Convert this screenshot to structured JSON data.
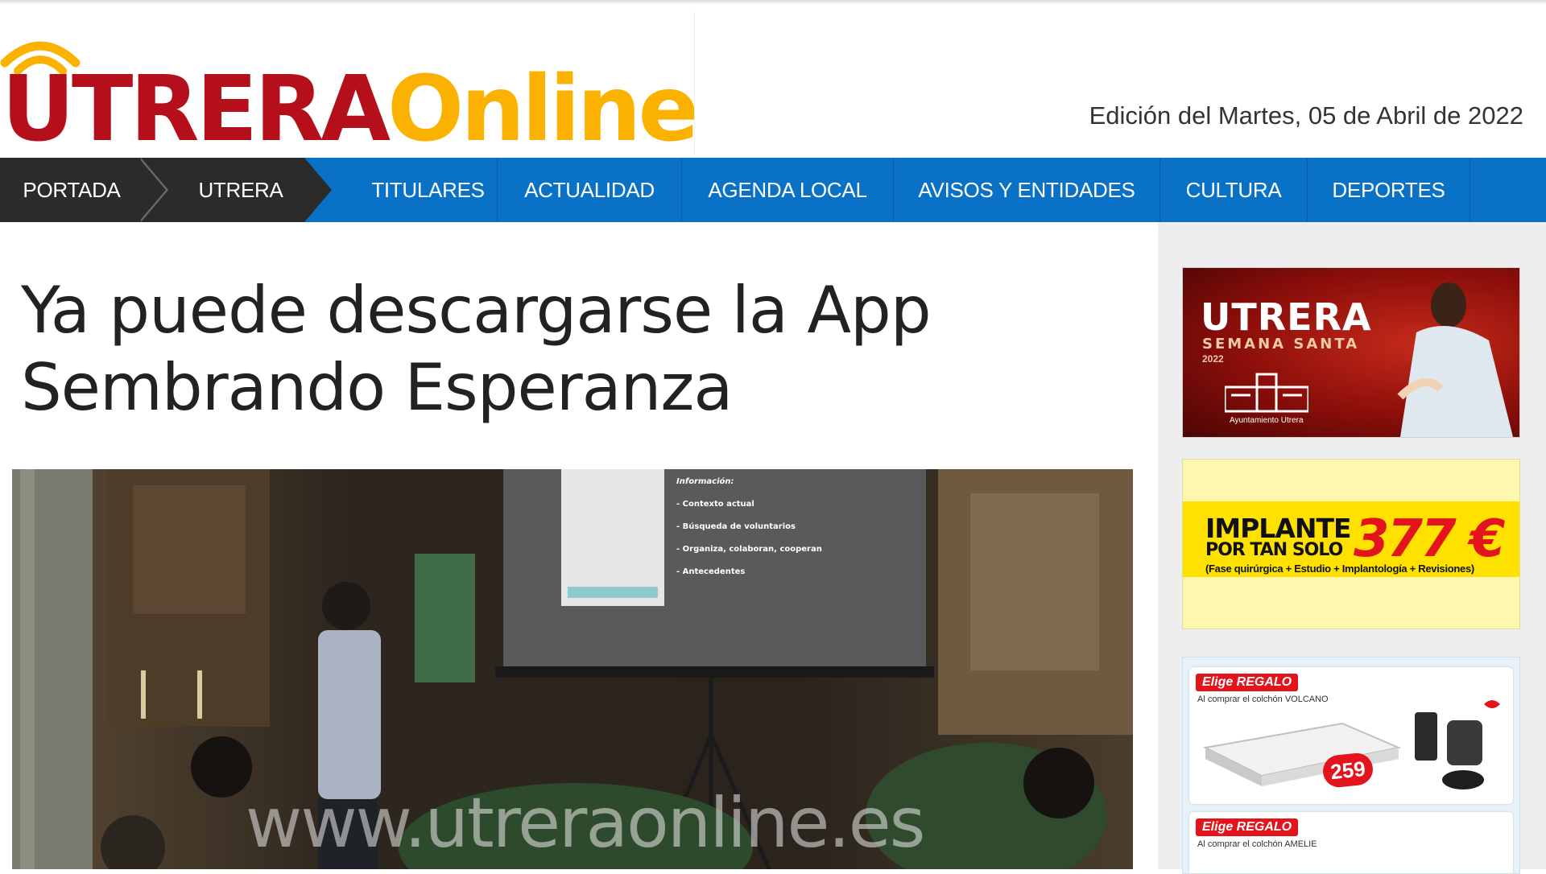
{
  "brand": {
    "logo_primary": "UTRERA",
    "logo_secondary": "Online",
    "colors": {
      "primary": "#b40f1b",
      "secondary": "#fbb100",
      "nav": "#0a72c6",
      "nav_dark": "#2b2b2b"
    }
  },
  "header": {
    "edition": "Edición del Martes, 05 de Abril de 2022"
  },
  "nav": {
    "items": [
      {
        "label": "PORTADA"
      },
      {
        "label": "UTRERA"
      },
      {
        "label": "TITULARES"
      },
      {
        "label": "ACTUALIDAD"
      },
      {
        "label": "AGENDA LOCAL"
      },
      {
        "label": "AVISOS Y ENTIDADES"
      },
      {
        "label": "CULTURA"
      },
      {
        "label": "DEPORTES"
      }
    ]
  },
  "article": {
    "title": "Ya puede descargarse la App Sembrando Esperanza",
    "photo": {
      "watermark": "www.utreraonline.es",
      "screen_heading": "Información:",
      "screen_bullets": [
        "- Contexto actual",
        "- Búsqueda de voluntarios",
        "- Organiza, colaboran, cooperan",
        "- Antecedentes"
      ]
    }
  },
  "sidebar": {
    "ads": [
      {
        "title": "UTRERA",
        "subtitle": "SEMANA SANTA",
        "year": "2022",
        "org": "Ayuntamiento Utrera"
      },
      {
        "line1": "IMPLANTE",
        "line2": "POR TAN SOLO",
        "price": "377 €",
        "note": "(Fase quirúrgica + Estudio + Implantología + Revisiones)"
      },
      {
        "tag": "Elige REGALO",
        "subtitle": "Al comprar el colchón VOLCANO",
        "price": "259",
        "tag2": "Elige REGALO",
        "subtitle2": "Al comprar el colchón AMELIE"
      }
    ]
  }
}
